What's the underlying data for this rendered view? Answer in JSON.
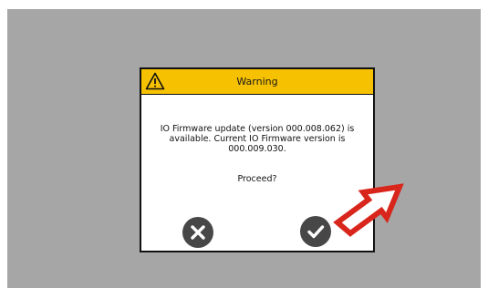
{
  "dialog": {
    "title": "Warning",
    "message": "IO Firmware update (version 000.008.062) is available. Current IO Firmware version is 000.009.030.",
    "question": "Proceed?",
    "icon": "warning-icon"
  },
  "buttons": {
    "cancel_icon": "close-icon",
    "confirm_icon": "checkmark-icon"
  },
  "colors": {
    "background": "#a6a6a6",
    "header": "#f6c100",
    "button": "#474747",
    "arrow": "#d9261c"
  }
}
